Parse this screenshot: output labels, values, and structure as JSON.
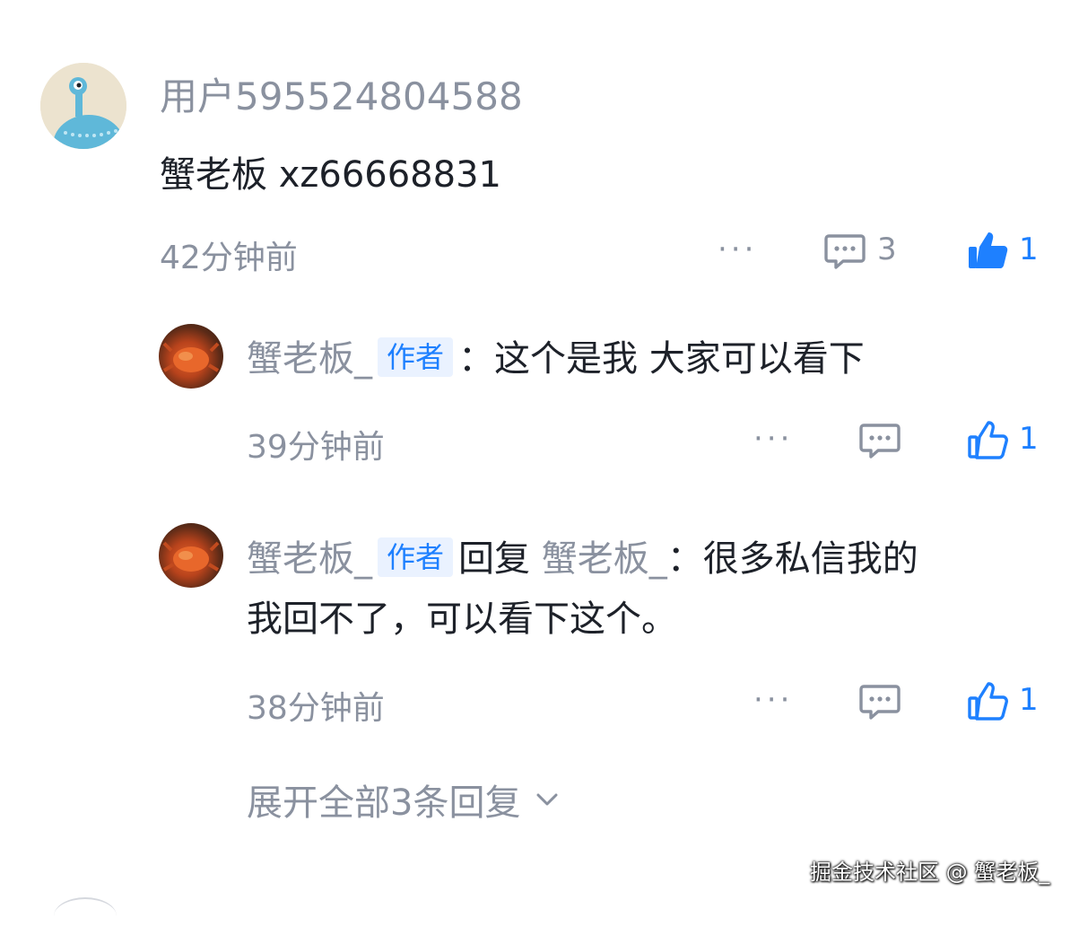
{
  "comment": {
    "username": "用户595524804588",
    "text": "蟹老板 xz66668831",
    "time": "42分钟前",
    "reply_count": "3",
    "like_count": "1",
    "liked": true
  },
  "replies": [
    {
      "author": "蟹老板_",
      "badge": "作者",
      "colon": "：",
      "text": "这个是我 大家可以看下",
      "time": "39分钟前",
      "like_count": "1"
    },
    {
      "author": "蟹老板_",
      "badge": "作者",
      "reply_word": "回复",
      "reply_to": "蟹老板_",
      "colon": "：",
      "text_line1": "很多私信我的",
      "text_line2": "我回不了，可以看下这个。",
      "time": "38分钟前",
      "like_count": "1"
    }
  ],
  "expand_label": "展开全部3条回复",
  "watermark": "掘金技术社区 @ 蟹老板_",
  "colors": {
    "accent": "#1e80ff",
    "muted": "#8a919f",
    "text": "#1d2129"
  }
}
